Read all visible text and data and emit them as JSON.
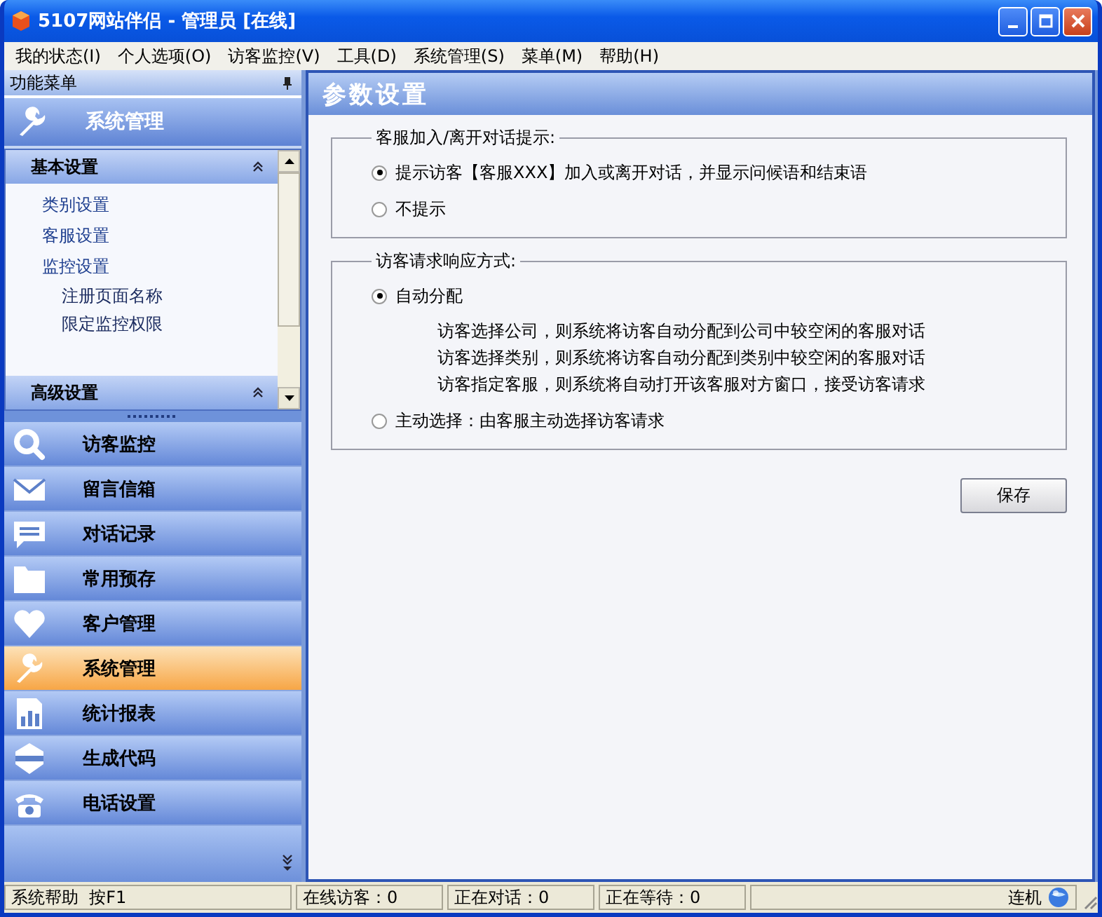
{
  "window": {
    "title": "5107网站伴侣 - 管理员 [在线]"
  },
  "menu": [
    "我的状态(I)",
    "个人选项(O)",
    "访客监控(V)",
    "工具(D)",
    "系统管理(S)",
    "菜单(M)",
    "帮助(H)"
  ],
  "sidebar": {
    "title": "功能菜单",
    "header": "系统管理",
    "groups": [
      {
        "label": "基本设置",
        "items": [
          {
            "label": "类别设置"
          },
          {
            "label": "客服设置"
          },
          {
            "label": "监控设置",
            "children": [
              {
                "label": "注册页面名称"
              },
              {
                "label": "限定监控权限"
              }
            ]
          }
        ]
      },
      {
        "label": "高级设置"
      }
    ],
    "nav": [
      {
        "label": "访客监控",
        "selected": false
      },
      {
        "label": "留言信箱",
        "selected": false
      },
      {
        "label": "对话记录",
        "selected": false
      },
      {
        "label": "常用预存",
        "selected": false
      },
      {
        "label": "客户管理",
        "selected": false
      },
      {
        "label": "系统管理",
        "selected": true
      },
      {
        "label": "统计报表",
        "selected": false
      },
      {
        "label": "生成代码",
        "selected": false
      },
      {
        "label": "电话设置",
        "selected": false
      }
    ]
  },
  "panel": {
    "title": "参数设置",
    "groups": [
      {
        "legend": "客服加入/离开对话提示:",
        "options": [
          {
            "label": "提示访客【客服XXX】加入或离开对话，并显示问候语和结束语",
            "selected": true
          },
          {
            "label": "不提示",
            "selected": false
          }
        ]
      },
      {
        "legend": "访客请求响应方式:",
        "options": [
          {
            "label": "自动分配",
            "selected": true,
            "notes": [
              "访客选择公司，则系统将访客自动分配到公司中较空闲的客服对话",
              "访客选择类别，则系统将访客自动分配到类别中较空闲的客服对话",
              "访客指定客服，则系统将自动打开该客服对方窗口，接受访客请求"
            ]
          },
          {
            "label": "主动选择：由客服主动选择访客请求",
            "selected": false
          }
        ]
      }
    ],
    "save_button": "保存"
  },
  "status_bar": {
    "help": "系统帮助  按F1",
    "fields": [
      "在线访客：0",
      "正在对话：0",
      "正在等待：0"
    ],
    "connection": "连机"
  }
}
